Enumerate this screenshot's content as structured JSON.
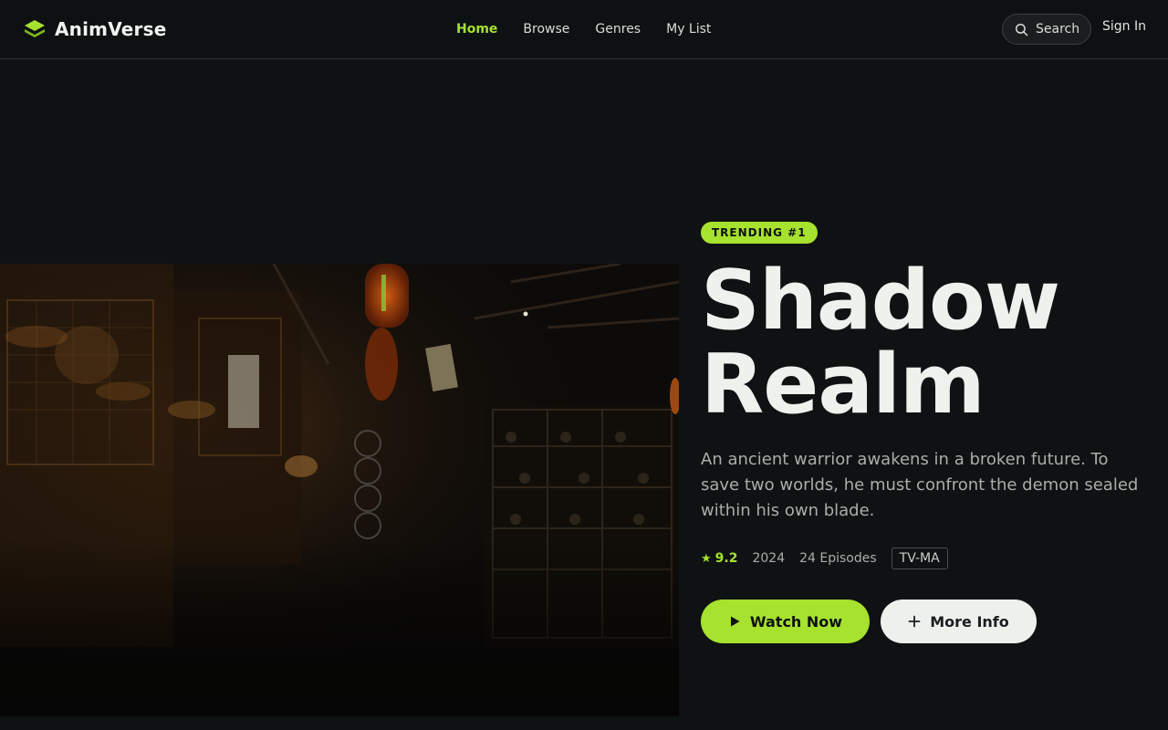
{
  "app": {
    "name": "AnimVerse",
    "brand_color": "#a6e22e"
  },
  "nav": {
    "items": [
      {
        "label": "Home",
        "active": true
      },
      {
        "label": "Browse",
        "active": false
      },
      {
        "label": "Genres",
        "active": false
      },
      {
        "label": "My List",
        "active": false
      }
    ]
  },
  "header": {
    "search_label": "Search",
    "search_icon": "search-icon",
    "signin_label": "Sign In"
  },
  "hero": {
    "badge": "TRENDING #1",
    "title_line1": "Shadow",
    "title_line2": "Realm",
    "description": "An ancient warrior awakens in a broken future. To save two worlds, he must confront the demon sealed within his own blade.",
    "rating": "9.2",
    "year": "2024",
    "episodes": "24 Episodes",
    "age_rating": "TV-MA",
    "watch_label": "Watch Now",
    "watch_icon": "play-icon",
    "more_label": "More Info",
    "more_icon": "plus-icon"
  }
}
